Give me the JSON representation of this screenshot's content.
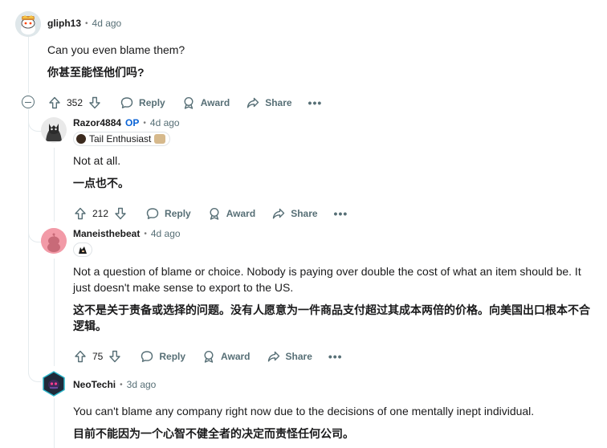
{
  "comments": [
    {
      "username": "gliph13",
      "time": "4d ago",
      "text_en": "Can you even blame them?",
      "text_cn": "你甚至能怪他们吗?",
      "votes": "352",
      "reply": "Reply",
      "award": "Award",
      "share": "Share",
      "more": "•••"
    },
    {
      "username": "Razor4884",
      "op": "OP",
      "time": "4d ago",
      "flair": "Tail Enthusiast",
      "text_en": "Not at all.",
      "text_cn": "一点也不。",
      "votes": "212",
      "reply": "Reply",
      "award": "Award",
      "share": "Share",
      "more": "•••"
    },
    {
      "username": "Maneisthebeat",
      "time": "4d ago",
      "text_en_1": "Not a question of blame or choice. Nobody is paying over double the cost of what an item should be. It",
      "text_en_2": "just doesn't make sense to export to the US.",
      "text_cn_1": "这不是关于责备或选择的问题。没有人愿意为一件商品支付超过其成本两倍的价格。向美国出口根本不合",
      "text_cn_2": "逻辑。",
      "votes": "75",
      "reply": "Reply",
      "award": "Award",
      "share": "Share",
      "more": "•••"
    },
    {
      "username": "NeoTechi",
      "time": "3d ago",
      "text_en": "You can't blame any company right now due to the decisions of one mentally inept individual.",
      "text_cn": "目前不能因为一个心智不健全者的决定而责怪任何公司。"
    }
  ],
  "colors": {
    "text": "#1a1a1b",
    "muted": "#576f76",
    "op": "#0a63d6",
    "thread_line": "#e5ebee"
  },
  "icons": [
    "upvote-icon",
    "downvote-icon",
    "reply-icon",
    "award-icon",
    "share-icon",
    "more-icon",
    "collapse-icon"
  ]
}
